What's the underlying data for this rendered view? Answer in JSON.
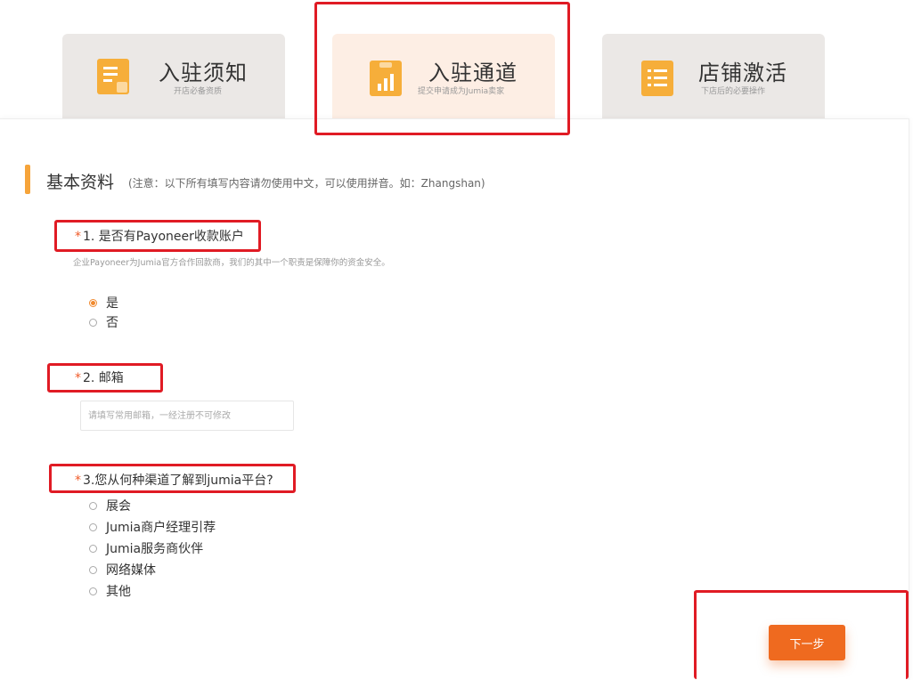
{
  "tabs": [
    {
      "title": "入驻须知",
      "subtitle": "开店必备资质",
      "icon": "document-icon",
      "active": false
    },
    {
      "title": "入驻通道",
      "subtitle": "提交申请成为Jumia卖家",
      "icon": "clipboard-chart-icon",
      "active": true
    },
    {
      "title": "店铺激活",
      "subtitle": "下店后的必要操作",
      "icon": "list-icon",
      "active": false
    }
  ],
  "section": {
    "title": "基本资料",
    "note": "(注意：以下所有填写内容请勿使用中文，可以使用拼音。如：Zhangshan)"
  },
  "questions": {
    "q1": {
      "required_mark": "*",
      "label": "1. 是否有Payoneer收款账户",
      "hint": "企业Payoneer为Jumia官方合作回款商，我们的其中一个职责是保障你的资金安全。",
      "options": [
        "是",
        "否"
      ],
      "selected": "是"
    },
    "q2": {
      "required_mark": "*",
      "label": "2. 邮箱",
      "placeholder": "请填写常用邮箱，一经注册不可修改"
    },
    "q3": {
      "required_mark": "*",
      "label": "3.您从何种渠道了解到jumia平台?",
      "options": [
        "展会",
        "Jumia商户经理引荐",
        "Jumia服务商伙伴",
        "网络媒体",
        "其他"
      ]
    }
  },
  "actions": {
    "next_label": "下一步"
  },
  "colors": {
    "accent": "#f6a43a",
    "primary_button": "#ef6a1f",
    "highlight_box": "#e01b24",
    "active_tab": "#fdeee4"
  }
}
